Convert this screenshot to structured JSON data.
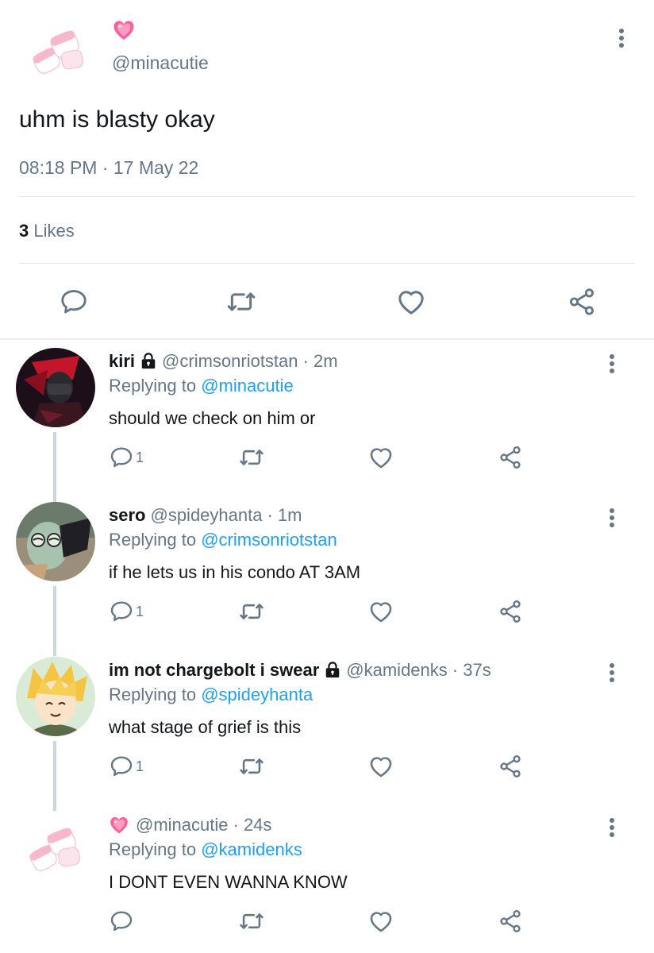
{
  "main_tweet": {
    "handle": "@minacutie",
    "text": "uhm is blasty okay",
    "timestamp": "08:18 PM · 17 May 22",
    "likes_count": "3",
    "likes_label": "Likes",
    "accent_heart_color": "#ff5c9a"
  },
  "replies": [
    {
      "name": "kiri",
      "locked": true,
      "handle": "@crimsonriotstan",
      "time": "· 2m",
      "replying_prefix": "Replying to",
      "replying_to": "@minacutie",
      "text": "should we check on him or",
      "reply_count": "1"
    },
    {
      "name": "sero",
      "locked": false,
      "handle": "@spideyhanta",
      "time": "· 1m",
      "replying_prefix": "Replying to",
      "replying_to": "@crimsonriotstan",
      "text": "if he lets us in his condo AT 3AM",
      "reply_count": "1"
    },
    {
      "name": "im not chargebolt i swear",
      "locked": true,
      "handle": "@kamidenks",
      "time": "· 37s",
      "replying_prefix": "Replying to",
      "replying_to": "@spideyhanta",
      "text": "what stage of grief is this",
      "reply_count": "1"
    },
    {
      "name": "",
      "locked": false,
      "handle": "@minacutie",
      "time": "· 24s",
      "replying_prefix": "Replying to",
      "replying_to": "@kamidenks",
      "text": "I DONT EVEN WANNA KNOW",
      "reply_count": ""
    }
  ],
  "colors": {
    "link": "#1da1f2",
    "secondary_text": "#657786",
    "icon": "#657786",
    "divider": "#e1e8ed"
  },
  "icons": {
    "reply": "reply-icon",
    "retweet": "retweet-icon",
    "like": "heart-icon",
    "share": "share-icon",
    "more": "more-vertical-icon",
    "lock": "lock-icon"
  }
}
